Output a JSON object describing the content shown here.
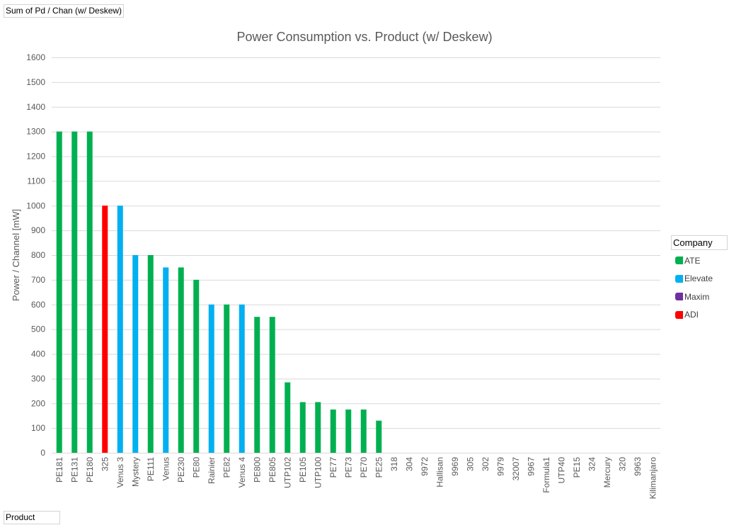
{
  "pivot_fields": {
    "value_field": "Sum of Pd / Chan (w/ Deskew)",
    "axis_field": "Product"
  },
  "legend": {
    "title": "Company",
    "items": [
      {
        "label": "ATE",
        "color": "#00b050"
      },
      {
        "label": "Elevate",
        "color": "#00b0f0"
      },
      {
        "label": "Maxim",
        "color": "#7030a0"
      },
      {
        "label": "ADI",
        "color": "#ff0000"
      }
    ]
  },
  "chart_data": {
    "type": "bar",
    "title": "Power Consumption vs. Product (w/ Deskew)",
    "xlabel": "",
    "ylabel": "Power / Channel [mW]",
    "ylim": [
      0,
      1600
    ],
    "yticks": [
      0,
      100,
      200,
      300,
      400,
      500,
      600,
      700,
      800,
      900,
      1000,
      1100,
      1200,
      1300,
      1400,
      1500,
      1600
    ],
    "grid": true,
    "legend_position": "right",
    "categories": [
      "PE181",
      "PE131",
      "PE180",
      "325",
      "Venus 3",
      "Mystery",
      "PE111",
      "Venus",
      "PE230",
      "PE80",
      "Rainier",
      "PE82",
      "Venus 4",
      "PE800",
      "PE805",
      "UTP102",
      "PE105",
      "UTP100",
      "PE77",
      "PE73",
      "PE70",
      "PE25",
      "318",
      "304",
      "9972",
      "Hallisan",
      "9969",
      "305",
      "302",
      "9979",
      "32007",
      "9967",
      "Formula1",
      "UTP40",
      "PE15",
      "324",
      "Mercury",
      "320",
      "9963",
      "Kilimanjaro"
    ],
    "series": [
      {
        "name": "ATE",
        "color": "#00b050",
        "values": [
          1300,
          1300,
          1300,
          null,
          null,
          null,
          800,
          null,
          750,
          700,
          null,
          600,
          null,
          550,
          550,
          285,
          205,
          205,
          175,
          175,
          175,
          130,
          null,
          null,
          null,
          null,
          null,
          null,
          null,
          null,
          null,
          null,
          null,
          null,
          null,
          null,
          null,
          null,
          null,
          null
        ]
      },
      {
        "name": "Elevate",
        "color": "#00b0f0",
        "values": [
          null,
          null,
          null,
          null,
          1000,
          800,
          null,
          750,
          null,
          null,
          600,
          null,
          600,
          null,
          null,
          null,
          null,
          null,
          null,
          null,
          null,
          null,
          null,
          null,
          null,
          null,
          null,
          null,
          null,
          null,
          null,
          null,
          null,
          null,
          null,
          null,
          null,
          null,
          null,
          null
        ]
      },
      {
        "name": "Maxim",
        "color": "#7030a0",
        "values": [
          null,
          null,
          null,
          null,
          null,
          null,
          null,
          null,
          null,
          null,
          null,
          null,
          null,
          null,
          null,
          null,
          null,
          null,
          null,
          null,
          null,
          null,
          null,
          null,
          null,
          null,
          null,
          null,
          null,
          null,
          null,
          null,
          null,
          null,
          null,
          null,
          null,
          null,
          null,
          null
        ]
      },
      {
        "name": "ADI",
        "color": "#ff0000",
        "values": [
          null,
          null,
          null,
          1000,
          null,
          null,
          null,
          null,
          null,
          null,
          null,
          null,
          null,
          null,
          null,
          null,
          null,
          null,
          null,
          null,
          null,
          null,
          null,
          null,
          null,
          null,
          null,
          null,
          null,
          null,
          null,
          null,
          null,
          null,
          null,
          null,
          null,
          null,
          null,
          null
        ]
      }
    ]
  }
}
